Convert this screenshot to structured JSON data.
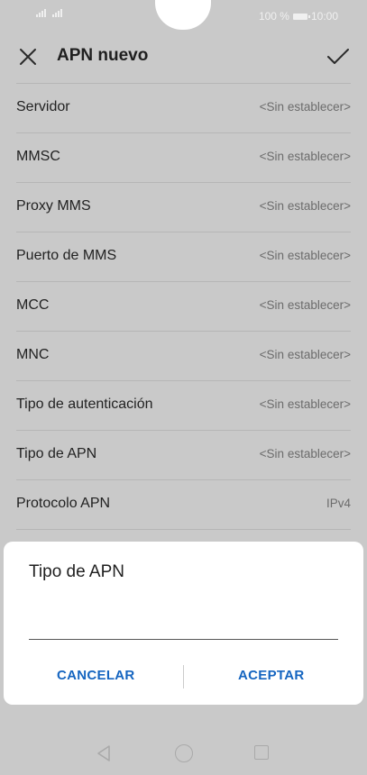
{
  "status_bar": {
    "battery_text": "100 %",
    "time": "10:00"
  },
  "app_bar": {
    "title": "APN nuevo"
  },
  "settings": [
    {
      "label": "Servidor",
      "value": "<Sin establecer>"
    },
    {
      "label": "MMSC",
      "value": "<Sin establecer>"
    },
    {
      "label": "Proxy MMS",
      "value": "<Sin establecer>"
    },
    {
      "label": "Puerto de MMS",
      "value": "<Sin establecer>"
    },
    {
      "label": "MCC",
      "value": "<Sin establecer>"
    },
    {
      "label": "MNC",
      "value": "<Sin establecer>"
    },
    {
      "label": "Tipo de autenticación",
      "value": "<Sin establecer>"
    },
    {
      "label": "Tipo de APN",
      "value": "<Sin establecer>"
    },
    {
      "label": "Protocolo APN",
      "value": "IPv4"
    }
  ],
  "dialog": {
    "title": "Tipo de APN",
    "input_value": "",
    "cancel_label": "CANCELAR",
    "ok_label": "ACEPTAR"
  },
  "colors": {
    "accent": "#1565c0",
    "overlay": "#c9c9c9"
  },
  "icons": [
    "close-icon",
    "check-icon",
    "back-icon",
    "home-icon",
    "recent-apps-icon",
    "signal-icon",
    "battery-icon"
  ]
}
